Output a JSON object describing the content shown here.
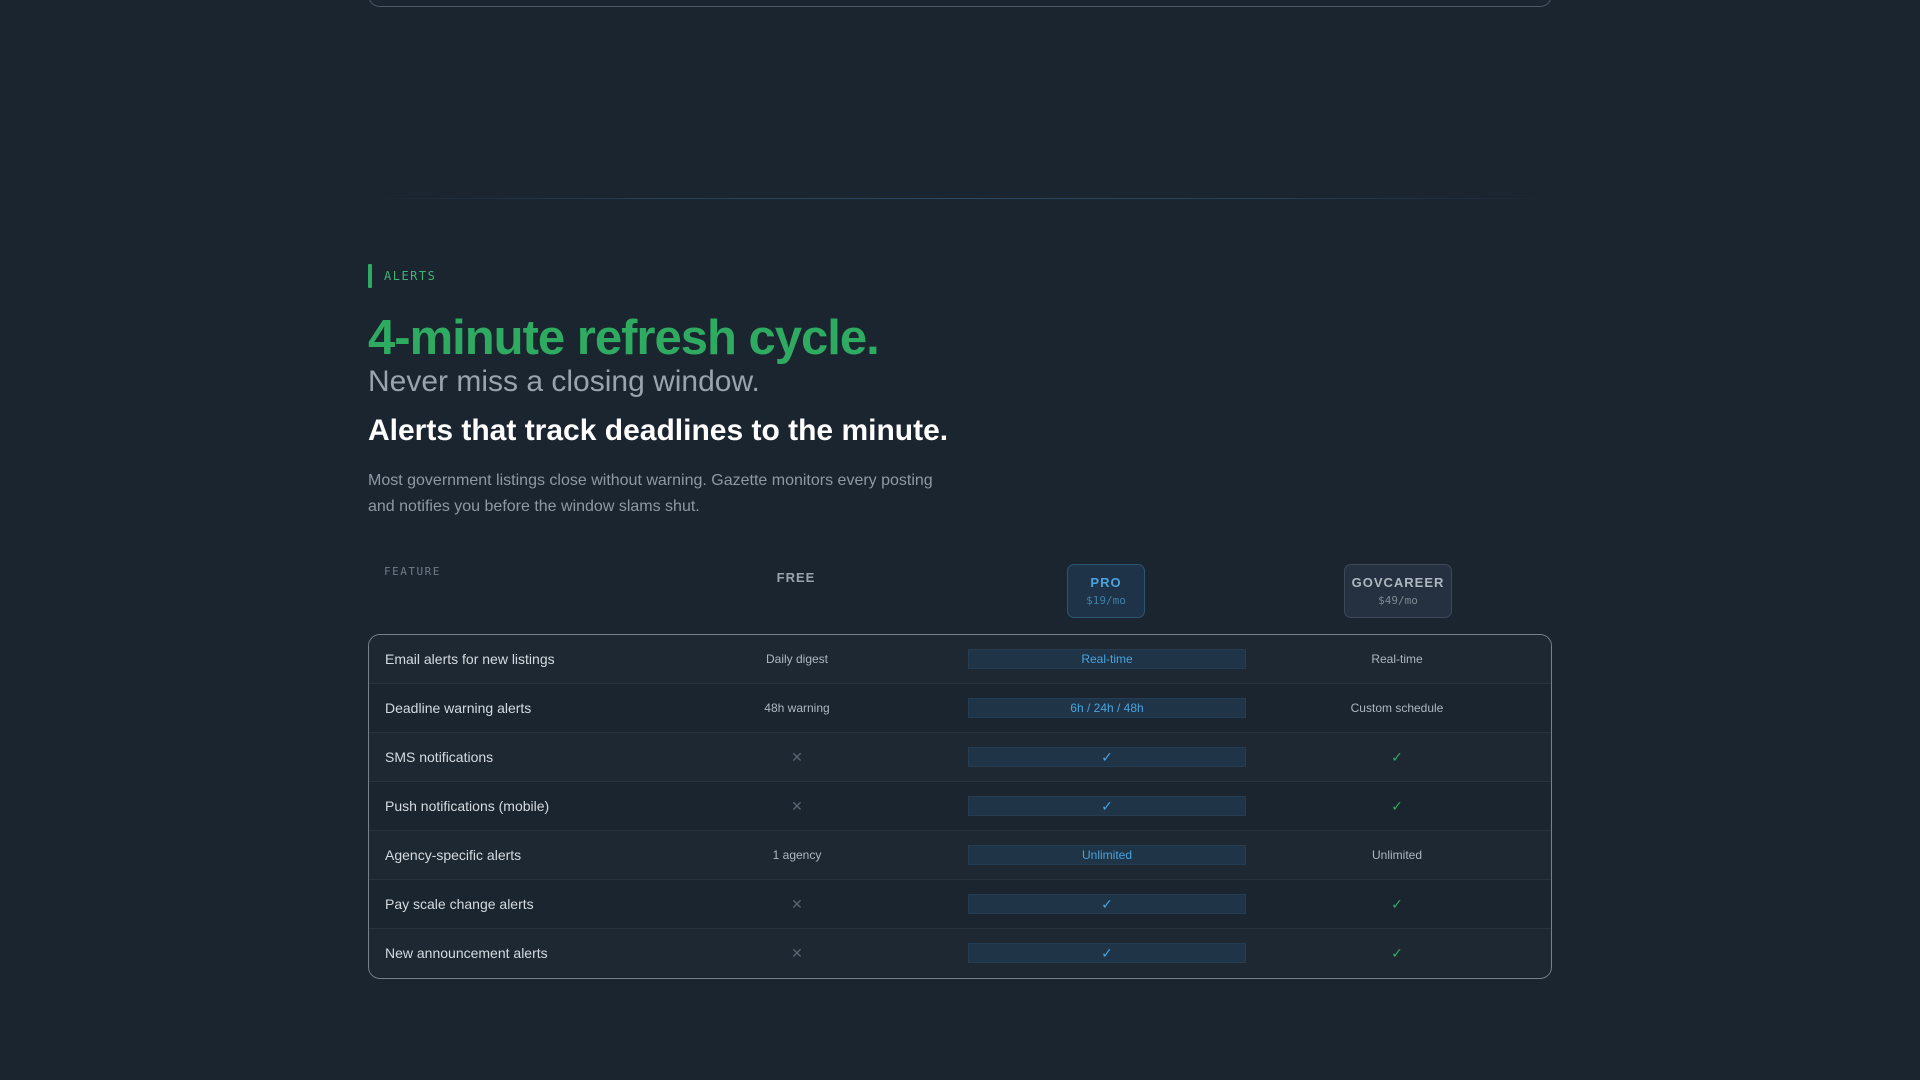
{
  "eyebrow": "ALERTS",
  "headline": "4-minute refresh cycle.",
  "subhead": "Never miss a closing window.",
  "title": "Alerts that track deadlines to the minute.",
  "body": "Most government listings close without warning. Gazette monitors every posting and notifies you before the window slams shut.",
  "plans": {
    "feature_label": "FEATURE",
    "free": {
      "name": "FREE"
    },
    "pro": {
      "name": "PRO",
      "price": "$19/mo"
    },
    "gov": {
      "name": "GOVCAREER",
      "price": "$49/mo"
    }
  },
  "rows": [
    {
      "feature": "Email alerts for new listings",
      "free": "Daily digest",
      "pro": "Real-time",
      "gov": "Real-time"
    },
    {
      "feature": "Deadline warning alerts",
      "free": "48h warning",
      "pro": "6h / 24h / 48h",
      "gov": "Custom schedule"
    },
    {
      "feature": "SMS notifications",
      "free": "x",
      "pro": "check",
      "gov": "check"
    },
    {
      "feature": "Push notifications (mobile)",
      "free": "x",
      "pro": "check",
      "gov": "check"
    },
    {
      "feature": "Agency-specific alerts",
      "free": "1 agency",
      "pro": "Unlimited",
      "gov": "Unlimited"
    },
    {
      "feature": "Pay scale change alerts",
      "free": "x",
      "pro": "check",
      "gov": "check"
    },
    {
      "feature": "New announcement alerts",
      "free": "x",
      "pro": "check",
      "gov": "check"
    }
  ],
  "icons": {
    "check": "check-icon",
    "x": "x-icon"
  },
  "colors": {
    "accent_green": "#2faa61",
    "accent_blue": "#4aa3df",
    "background": "#1b2530"
  }
}
